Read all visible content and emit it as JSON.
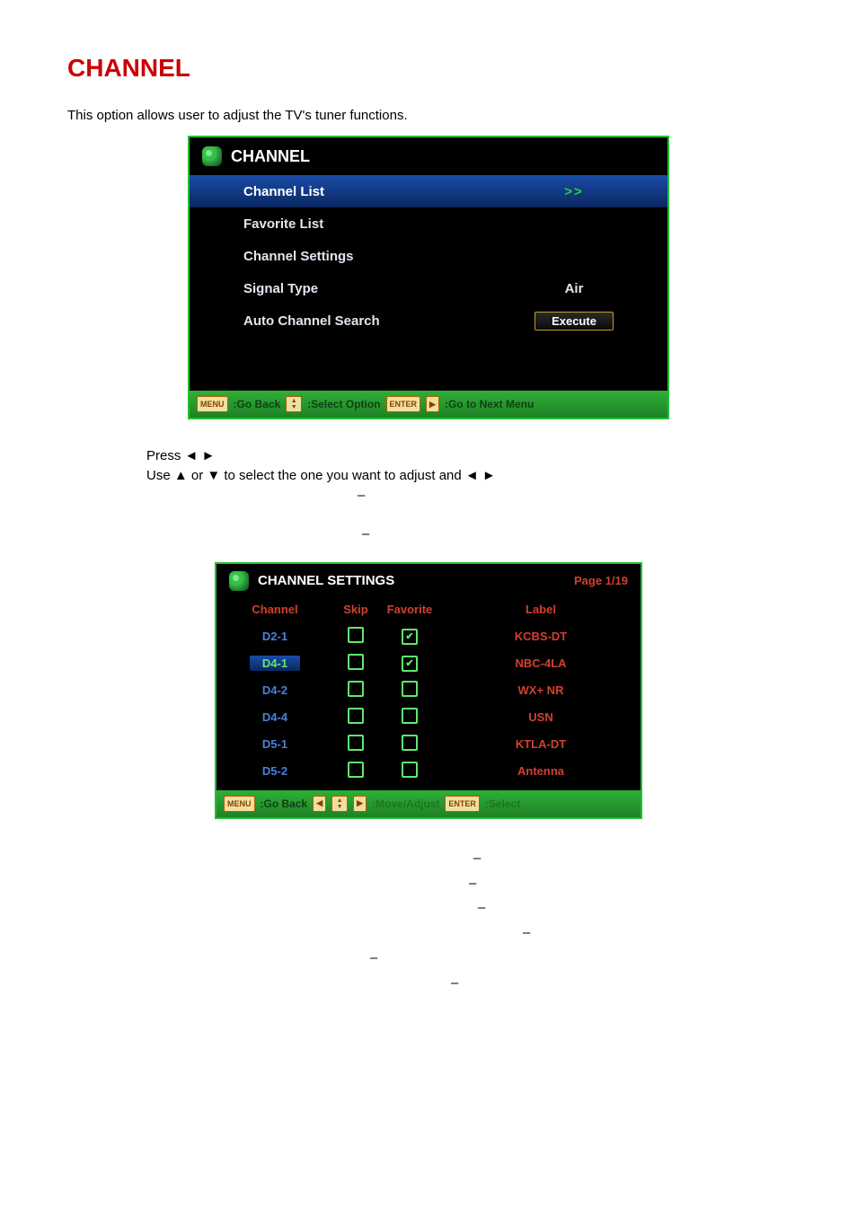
{
  "heading": "CHANNEL",
  "intro": "This option allows user to adjust the TV's tuner functions.",
  "screenshot1": {
    "title": "CHANNEL",
    "rows": [
      {
        "label": "Channel List",
        "value_type": "arrows",
        "value": ">>",
        "selected": true
      },
      {
        "label": "Favorite List",
        "value_type": "none",
        "value": "",
        "selected": false
      },
      {
        "label": "Channel Settings",
        "value_type": "none",
        "value": "",
        "selected": false
      },
      {
        "label": "Signal Type",
        "value_type": "text",
        "value": "Air",
        "selected": false
      },
      {
        "label": "Auto Channel Search",
        "value_type": "button",
        "value": "Execute",
        "selected": false
      }
    ],
    "footer": {
      "menu_key": "MENU",
      "go_back": ":Go Back",
      "select_option": ":Select Option",
      "enter_key": "ENTER",
      "right_key": "▶",
      "go_next": ":Go to Next Menu"
    }
  },
  "instructions": {
    "line1_prefix": "Press ",
    "line1_arrows": "◄    ►",
    "line2_prefix": "Use ▲ or ▼ to select the one you want to adjust and ",
    "line2_arrows": "◄    ►",
    "dash1": "–",
    "dash2": "–"
  },
  "screenshot2": {
    "title": "CHANNEL SETTINGS",
    "page": "Page 1/19",
    "headers": {
      "channel": "Channel",
      "skip": "Skip",
      "favorite": "Favorite",
      "label": "Label"
    },
    "rows": [
      {
        "channel": "D2-1",
        "skip": false,
        "favorite": true,
        "label": "KCBS-DT",
        "selected": false
      },
      {
        "channel": "D4-1",
        "skip": false,
        "favorite": true,
        "label": "NBC-4LA",
        "selected": true
      },
      {
        "channel": "D4-2",
        "skip": false,
        "favorite": false,
        "label": "WX+ NR",
        "selected": false
      },
      {
        "channel": "D4-4",
        "skip": false,
        "favorite": false,
        "label": "USN",
        "selected": false
      },
      {
        "channel": "D5-1",
        "skip": false,
        "favorite": false,
        "label": "KTLA-DT",
        "selected": false
      },
      {
        "channel": "D5-2",
        "skip": false,
        "favorite": false,
        "label": "Antenna",
        "selected": false
      }
    ],
    "footer": {
      "menu_key": "MENU",
      "go_back": ":Go Back",
      "enter_key": "ENTER",
      "select": ":Select"
    }
  },
  "trailing_dashes": [
    "–",
    "–",
    "–",
    "–",
    "–",
    "–"
  ],
  "chart_data": {
    "type": "table",
    "title": "CHANNEL SETTINGS",
    "page": "1/19",
    "columns": [
      "Channel",
      "Skip",
      "Favorite",
      "Label"
    ],
    "rows": [
      [
        "D2-1",
        false,
        true,
        "KCBS-DT"
      ],
      [
        "D4-1",
        false,
        true,
        "NBC-4LA"
      ],
      [
        "D4-2",
        false,
        false,
        "WX+ NR"
      ],
      [
        "D4-4",
        false,
        false,
        "USN"
      ],
      [
        "D5-1",
        false,
        false,
        "KTLA-DT"
      ],
      [
        "D5-2",
        false,
        false,
        "Antenna"
      ]
    ]
  }
}
